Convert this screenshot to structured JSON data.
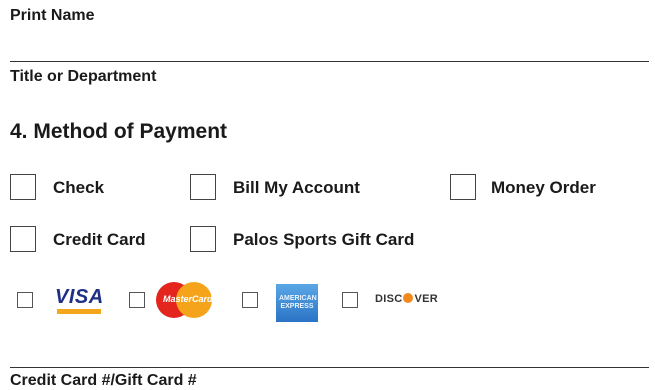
{
  "fields": {
    "print_name": "Print Name",
    "title_or_department": "Title or Department",
    "card_number": "Credit Card #/Gift Card #"
  },
  "section": {
    "heading": "4. Method of Payment"
  },
  "payment_options": {
    "check": "Check",
    "bill_my_account": "Bill My Account",
    "money_order": "Money Order",
    "credit_card": "Credit Card",
    "gift_card": "Palos Sports Gift Card"
  },
  "card_logos": {
    "visa": "VISA",
    "mastercard": "MasterCard",
    "amex": "AMERICAN EXPRESS",
    "discover_a": "DISC",
    "discover_b": "VER"
  },
  "colors": {
    "visa_blue": "#1f2f86",
    "visa_gold": "#f4a61c",
    "mastercard_red": "#e4251d",
    "mastercard_orange": "#f6a31c",
    "amex_blue": "#2b73c5",
    "discover_orange": "#f08a1e"
  }
}
